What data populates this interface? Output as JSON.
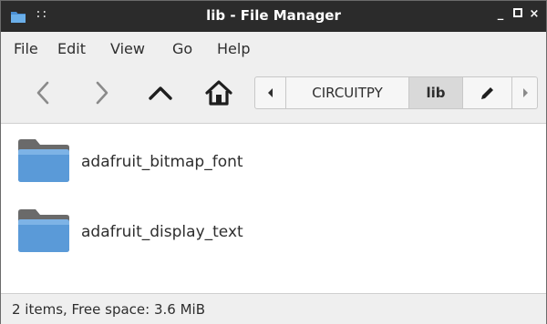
{
  "window": {
    "title": "lib - File Manager",
    "menu_dots": "::",
    "minimize": "_",
    "maximize": "□",
    "close": "×"
  },
  "menubar": {
    "items": [
      {
        "label": "File"
      },
      {
        "label": "Edit"
      },
      {
        "label": "View"
      },
      {
        "label": "Go"
      },
      {
        "label": "Help"
      }
    ]
  },
  "toolbar": {
    "icons": {
      "back": "chevron-left-icon",
      "forward": "chevron-right-icon",
      "up": "chevron-up-icon",
      "home": "home-icon",
      "edit": "pencil-icon"
    },
    "path": {
      "segments": [
        {
          "label": "CIRCUITPY"
        },
        {
          "label": "lib",
          "active": true
        }
      ]
    }
  },
  "files": [
    {
      "name": "adafruit_bitmap_font",
      "icon": "folder-icon"
    },
    {
      "name": "adafruit_display_text",
      "icon": "folder-icon"
    }
  ],
  "status": {
    "text": "2 items, Free space: 3.6 MiB"
  },
  "colors": {
    "titlebar": "#2b2b2b",
    "chrome": "#efefef",
    "active_segment": "#d9d9d9",
    "folder_front": "#5a9ad8",
    "folder_back": "#6a6a6a"
  }
}
